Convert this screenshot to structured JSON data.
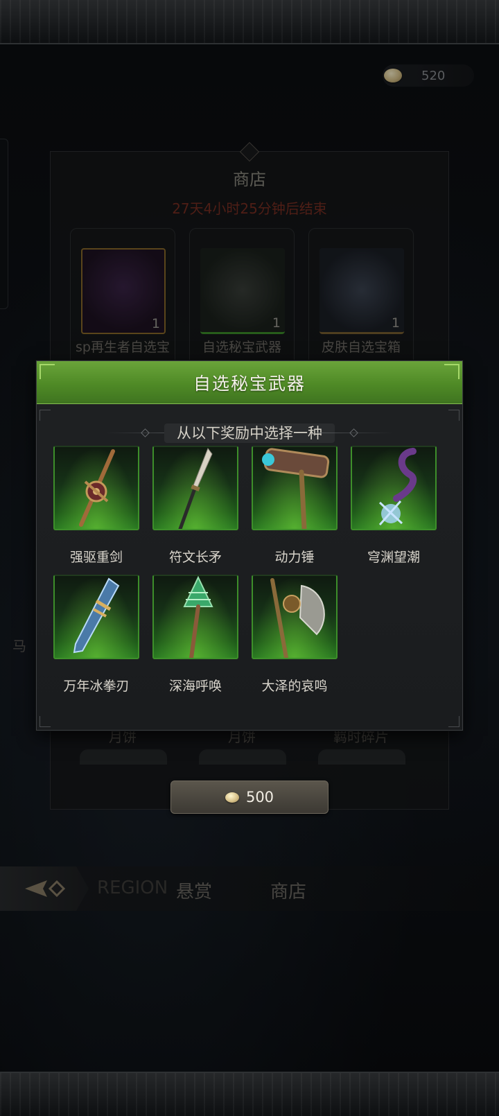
{
  "currency": {
    "amount": "520",
    "icon": "mooncake-coin-icon"
  },
  "shop": {
    "title": "商店",
    "countdown": "27天4小时25分钟后结束",
    "items": [
      {
        "name": "sp再生者自选宝",
        "qty": "1",
        "second_name": "月饼",
        "icon": "dark-armor-icon"
      },
      {
        "name": "自选秘宝武器",
        "qty": "1",
        "second_name": "月饼",
        "icon": "weapon-rack-icon"
      },
      {
        "name": "皮肤自选宝箱",
        "qty": "1",
        "second_name": "羁时碎片",
        "icon": "chest-icon"
      }
    ],
    "buy_amount": "500"
  },
  "nav": {
    "tabs": [
      "悬赏",
      "商店"
    ],
    "faded_tab": "REGION"
  },
  "side_text": "马",
  "modal": {
    "title": "自选秘宝武器",
    "subtitle": "从以下奖励中选择一种",
    "rewards": [
      {
        "name": "强驱重剑",
        "icon": "greatsword-icon"
      },
      {
        "name": "符文长矛",
        "icon": "spear-icon"
      },
      {
        "name": "动力锤",
        "icon": "hammer-icon"
      },
      {
        "name": "穹渊望潮",
        "icon": "tentacle-staff-icon"
      },
      {
        "name": "万年冰拳刃",
        "icon": "ice-blade-icon"
      },
      {
        "name": "深海呼唤",
        "icon": "shell-mace-icon"
      },
      {
        "name": "大泽的哀鸣",
        "icon": "axe-icon"
      }
    ]
  },
  "colors": {
    "header_green": "#5a9a2e",
    "countdown_red": "#7a2f22",
    "thumb_green": "#2a7a22"
  }
}
